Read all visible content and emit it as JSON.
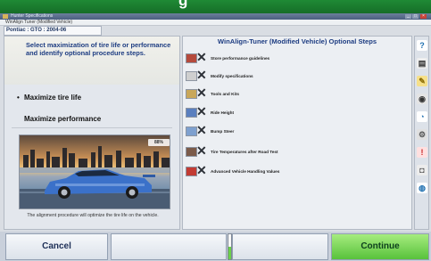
{
  "banner": {
    "partial_text": "g"
  },
  "window": {
    "title": "Hunter Specifications",
    "menu_text": "WinAlign Tuner (Modified Vehicle)",
    "controls": [
      "_",
      "□",
      "×"
    ]
  },
  "vehicle": {
    "label": "Pontiac : GTO : 2004-06"
  },
  "instructions": "Select maximization of tire life or performance and identify optional procedure steps.",
  "options": [
    {
      "mark": "•",
      "label": "Maximize tire life"
    },
    {
      "mark": "",
      "label": "Maximize performance"
    }
  ],
  "image_badge": "88%",
  "caption": "The alignment procedure will optimize the tire life on the vehicle.",
  "panel": {
    "title": "WinAlign-Tuner (Modified Vehicle) Optional Steps",
    "steps": [
      {
        "label": "Store performance guidelines",
        "icon": "book-icon",
        "color": "#b54a3c"
      },
      {
        "label": "Modify specifications",
        "icon": "specs-icon",
        "color": "#cfcfcf"
      },
      {
        "label": "Tools and Kits",
        "icon": "tools-icon",
        "color": "#c9a75a"
      },
      {
        "label": "Ride Height",
        "icon": "ride-height-icon",
        "color": "#5a7fbf"
      },
      {
        "label": "Bump Steer",
        "icon": "bump-steer-icon",
        "color": "#7ea0cf"
      },
      {
        "label": "Tire Temperatures after Road Test",
        "icon": "tire-temp-icon",
        "color": "#7b5b4a"
      },
      {
        "label": "Advanced Vehicle Handling Values",
        "icon": "handling-icon",
        "color": "#c23b33"
      }
    ]
  },
  "side_icons": [
    {
      "name": "help-icon",
      "glyph": "?",
      "color": "#1e6fb0",
      "bg": "#ffffff"
    },
    {
      "name": "printer-icon",
      "glyph": "▤",
      "color": "#333333",
      "bg": "#eeeeee"
    },
    {
      "name": "pencil-icon",
      "glyph": "✎",
      "color": "#8a6a00",
      "bg": "#f6e08a"
    },
    {
      "name": "tire-icon",
      "glyph": "◉",
      "color": "#333333",
      "bg": "#e4e4e4"
    },
    {
      "name": "gauge-icon",
      "glyph": "◔",
      "color": "#1e6fb0",
      "bg": "#ffffff"
    },
    {
      "name": "wrench-icon",
      "glyph": "⚙",
      "color": "#555555",
      "bg": "#e0e0e0"
    },
    {
      "name": "alert-icon",
      "glyph": "!",
      "color": "#c82828",
      "bg": "#ffe0e0"
    },
    {
      "name": "camera-icon",
      "glyph": "◘",
      "color": "#5a5a5a",
      "bg": "#ececec"
    },
    {
      "name": "globe-icon",
      "glyph": "◍",
      "color": "#1e6fb0",
      "bg": "#ffffff"
    }
  ],
  "buttons": {
    "cancel": "Cancel",
    "blank1": "",
    "blank2": "",
    "continue": "Continue"
  },
  "gauge_level": 0.5
}
